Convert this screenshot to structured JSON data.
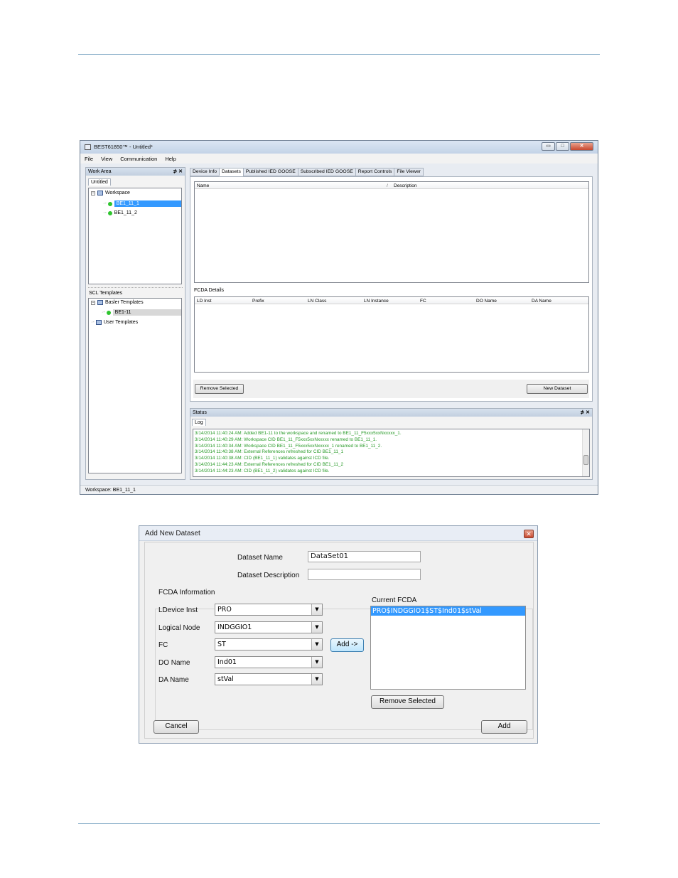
{
  "app": {
    "title": "BEST61850™ - Untitled*",
    "window_buttons": {
      "minimize": "▭",
      "maximize": "□",
      "close": "✕"
    },
    "menu": [
      "File",
      "View",
      "Communication",
      "Help"
    ],
    "work_area": {
      "header": "Work Area",
      "pins": "⊅ ✕",
      "tab": "Untitled",
      "workspace_label": "Workspace",
      "devices": [
        "BE1_11_1",
        "BE1_11_2"
      ],
      "sct_label": "SCL Templates",
      "basler_label": "Basler Templates",
      "basler_item": "BE1-11",
      "user_label": "User Templates"
    },
    "tabs": [
      "Device Info",
      "Datasets",
      "Published IED GOOSE",
      "Subscribed IED GOOSE",
      "Report Controls",
      "File Viewer"
    ],
    "datasets": {
      "col_name": "Name",
      "sort_glyph": "/",
      "col_desc": "Description",
      "fcda_label": "FCDA Details",
      "fcda_cols": [
        "LD Inst",
        "Prefix",
        "LN Class",
        "LN Instance",
        "FC",
        "DO Name",
        "DA Name"
      ],
      "remove_btn": "Remove Selected",
      "new_btn": "New Dataset"
    },
    "status": {
      "header": "Status",
      "pins": "⊅ ✕",
      "tab": "Log",
      "lines": [
        "3/14/2014 11:40:24 AM: Added BE1-11 to the workspace and renamed to BE1_11_F5xxx5xxNxxxxx_1.",
        "3/14/2014 11:40:29 AM: Workspace CID BE1_11_F5xxx5xxNxxxxx renamed to BE1_11_1.",
        "3/14/2014 11:40:34 AM: Workspace CID BE1_11_F5xxx5xxNxxxxx_1 renamed to BE1_11_2.",
        "3/14/2014 11:40:38 AM: External References refreshed for CID BE1_11_1",
        "3/14/2014 11:40:38 AM: CID (BE1_11_1) validates against ICD file.",
        "3/14/2014 11:44:23 AM: External References refreshed for CID BE1_11_2",
        "3/14/2014 11:44:23 AM: CID (BE1_11_2) validates against ICD file."
      ]
    },
    "statusbar": "Workspace: BE1_11_1"
  },
  "dialog": {
    "title": "Add New Dataset",
    "close": "✕",
    "dataset_name_label": "Dataset Name",
    "dataset_name_value": "DataSet01",
    "dataset_desc_label": "Dataset Description",
    "dataset_desc_value": "",
    "fcda_group": "FCDA Information",
    "fields": [
      {
        "label": "LDevice Inst",
        "value": "PRO"
      },
      {
        "label": "Logical Node",
        "value": "INDGGIO1"
      },
      {
        "label": "FC",
        "value": "ST"
      },
      {
        "label": "DO Name",
        "value": "Ind01"
      },
      {
        "label": "DA Name",
        "value": "stVal"
      }
    ],
    "combo_arrow": "▼",
    "add_arrow_btn": "Add ->",
    "current_fcda_label": "Current FCDA",
    "current_fcda_items": [
      "PRO$INDGGIO1$ST$Ind01$stVal"
    ],
    "remove_selected": "Remove Selected",
    "cancel": "Cancel",
    "add": "Add"
  }
}
